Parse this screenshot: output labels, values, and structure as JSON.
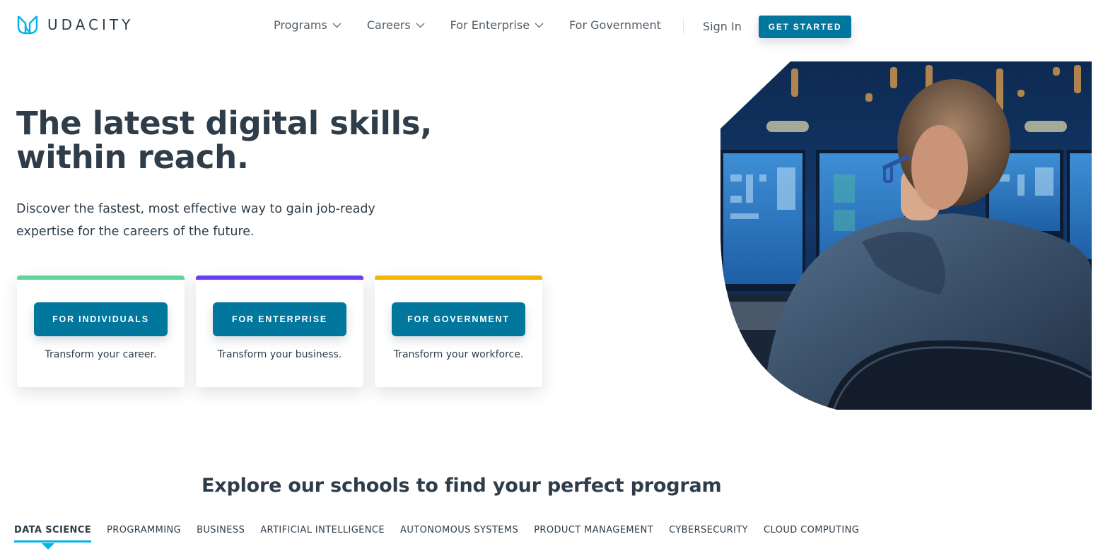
{
  "brand": {
    "name": "UDACITY",
    "logo_icon": "udacity-u-icon",
    "accent": "#02b3e4",
    "primary_button": "#02779e",
    "text_dark": "#2e3d49"
  },
  "header": {
    "nav": [
      {
        "label": "Programs",
        "has_dropdown": true
      },
      {
        "label": "Careers",
        "has_dropdown": true
      },
      {
        "label": "For Enterprise",
        "has_dropdown": true
      },
      {
        "label": "For Government",
        "has_dropdown": false
      }
    ],
    "sign_in": "Sign In",
    "get_started": "GET STARTED"
  },
  "hero": {
    "title_line1": "The latest digital skills,",
    "title_line2": "within reach.",
    "subtitle_line1": "Discover the fastest, most effective way to gain job-ready",
    "subtitle_line2": "expertise for the careers of the future.",
    "image_alt": "Man with glasses working at monitors in a control room",
    "cards": [
      {
        "button": "FOR INDIVIDUALS",
        "text": "Transform your career.",
        "accent": "#5fd49a"
      },
      {
        "button": "FOR ENTERPRISE",
        "text": "Transform your business.",
        "accent": "#6b3cf6"
      },
      {
        "button": "FOR GOVERNMENT",
        "text": "Transform your workforce.",
        "accent": "#f5b400"
      }
    ]
  },
  "schools": {
    "title": "Explore our schools to find your perfect program",
    "active_tab": "DATA SCIENCE",
    "tabs": [
      "DATA SCIENCE",
      "PROGRAMMING",
      "BUSINESS",
      "ARTIFICIAL INTELLIGENCE",
      "AUTONOMOUS SYSTEMS",
      "PRODUCT MANAGEMENT",
      "CYBERSECURITY",
      "CLOUD COMPUTING"
    ]
  }
}
